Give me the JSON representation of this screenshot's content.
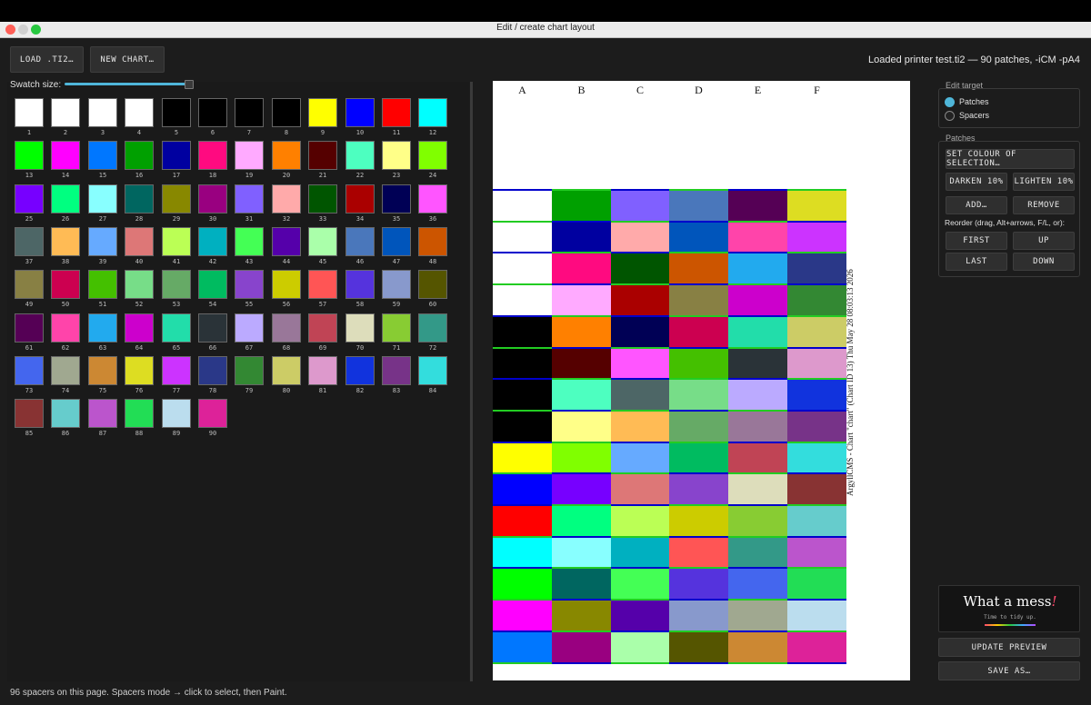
{
  "window": {
    "title": "Edit / create chart layout"
  },
  "toolbar": {
    "load_label": "LOAD .TI2…",
    "new_chart_label": "NEW CHART…"
  },
  "status_top": "Loaded printer test.ti2 — 90 patches, -iCM -pA4",
  "swatch_size": {
    "label": "Swatch size:",
    "value_fraction": 1.0
  },
  "swatches": [
    {
      "n": "1",
      "c": "#ffffff"
    },
    {
      "n": "2",
      "c": "#ffffff"
    },
    {
      "n": "3",
      "c": "#ffffff"
    },
    {
      "n": "4",
      "c": "#ffffff"
    },
    {
      "n": "5",
      "c": "#000000"
    },
    {
      "n": "6",
      "c": "#000000"
    },
    {
      "n": "7",
      "c": "#000000"
    },
    {
      "n": "8",
      "c": "#000000"
    },
    {
      "n": "9",
      "c": "#ffff00"
    },
    {
      "n": "10",
      "c": "#0000ff"
    },
    {
      "n": "11",
      "c": "#ff0000"
    },
    {
      "n": "12",
      "c": "#00ffff"
    },
    {
      "n": "13",
      "c": "#00ff00"
    },
    {
      "n": "14",
      "c": "#ff00ff"
    },
    {
      "n": "15",
      "c": "#0077ff"
    },
    {
      "n": "16",
      "c": "#00a000"
    },
    {
      "n": "17",
      "c": "#0000a0"
    },
    {
      "n": "18",
      "c": "#ff0a80"
    },
    {
      "n": "19",
      "c": "#ffaaff"
    },
    {
      "n": "20",
      "c": "#ff8000"
    },
    {
      "n": "21",
      "c": "#550000"
    },
    {
      "n": "22",
      "c": "#4dffc0"
    },
    {
      "n": "23",
      "c": "#ffff88"
    },
    {
      "n": "24",
      "c": "#80ff00"
    },
    {
      "n": "25",
      "c": "#7700ff"
    },
    {
      "n": "26",
      "c": "#00ff80"
    },
    {
      "n": "27",
      "c": "#88ffff"
    },
    {
      "n": "28",
      "c": "#006660"
    },
    {
      "n": "29",
      "c": "#888800"
    },
    {
      "n": "30",
      "c": "#990080"
    },
    {
      "n": "31",
      "c": "#8060ff"
    },
    {
      "n": "32",
      "c": "#ffaaaa"
    },
    {
      "n": "33",
      "c": "#005500"
    },
    {
      "n": "34",
      "c": "#aa0000"
    },
    {
      "n": "35",
      "c": "#000055"
    },
    {
      "n": "36",
      "c": "#ff55ff"
    },
    {
      "n": "37",
      "c": "#4d6666"
    },
    {
      "n": "38",
      "c": "#ffbb55"
    },
    {
      "n": "39",
      "c": "#66aaff"
    },
    {
      "n": "40",
      "c": "#dd7777"
    },
    {
      "n": "41",
      "c": "#bbff55"
    },
    {
      "n": "42",
      "c": "#00b0c0"
    },
    {
      "n": "43",
      "c": "#44ff55"
    },
    {
      "n": "44",
      "c": "#5500aa"
    },
    {
      "n": "45",
      "c": "#aaffaa"
    },
    {
      "n": "46",
      "c": "#4a77bb"
    },
    {
      "n": "47",
      "c": "#0055bb"
    },
    {
      "n": "48",
      "c": "#cc5500"
    },
    {
      "n": "49",
      "c": "#888044"
    },
    {
      "n": "50",
      "c": "#cc0050"
    },
    {
      "n": "51",
      "c": "#44c000"
    },
    {
      "n": "52",
      "c": "#77dd88"
    },
    {
      "n": "53",
      "c": "#66aa66"
    },
    {
      "n": "54",
      "c": "#00bb60"
    },
    {
      "n": "55",
      "c": "#8844cc"
    },
    {
      "n": "56",
      "c": "#cccc00"
    },
    {
      "n": "57",
      "c": "#ff5555"
    },
    {
      "n": "58",
      "c": "#5533dd"
    },
    {
      "n": "59",
      "c": "#8899cc"
    },
    {
      "n": "60",
      "c": "#555500"
    },
    {
      "n": "61",
      "c": "#550055"
    },
    {
      "n": "62",
      "c": "#ff44aa"
    },
    {
      "n": "63",
      "c": "#22aaee"
    },
    {
      "n": "64",
      "c": "#cc00cc"
    },
    {
      "n": "65",
      "c": "#22ddaa"
    },
    {
      "n": "66",
      "c": "#2a3338"
    },
    {
      "n": "67",
      "c": "#bbaaff"
    },
    {
      "n": "68",
      "c": "#997799"
    },
    {
      "n": "69",
      "c": "#c04455"
    },
    {
      "n": "70",
      "c": "#ddddbb"
    },
    {
      "n": "71",
      "c": "#88cc33"
    },
    {
      "n": "72",
      "c": "#339988"
    },
    {
      "n": "73",
      "c": "#4466ee"
    },
    {
      "n": "74",
      "c": "#a0a890"
    },
    {
      "n": "75",
      "c": "#cc8833"
    },
    {
      "n": "76",
      "c": "#dddd22"
    },
    {
      "n": "77",
      "c": "#cc33ff"
    },
    {
      "n": "78",
      "c": "#2a3888"
    },
    {
      "n": "79",
      "c": "#338833"
    },
    {
      "n": "80",
      "c": "#cccc66"
    },
    {
      "n": "81",
      "c": "#dd99cc"
    },
    {
      "n": "82",
      "c": "#1133dd"
    },
    {
      "n": "83",
      "c": "#773388"
    },
    {
      "n": "84",
      "c": "#33dddd"
    },
    {
      "n": "85",
      "c": "#883333"
    },
    {
      "n": "86",
      "c": "#66cccc"
    },
    {
      "n": "87",
      "c": "#bb55cc"
    },
    {
      "n": "88",
      "c": "#22dd55"
    },
    {
      "n": "89",
      "c": "#bbddee"
    },
    {
      "n": "90",
      "c": "#dd2299"
    }
  ],
  "chart": {
    "columns": [
      "A",
      "B",
      "C",
      "D",
      "E",
      "F"
    ],
    "vertical_text": "ArgyllCMS - Chart \"chart\" (Chart ID 13) Thu May 28 08:03:13 2026",
    "cells": [
      [
        "#ffffff",
        "#ffffff",
        "#ffffff",
        "#ffffff",
        "#000000",
        "#000000",
        "#000000",
        "#000000",
        "#ffff00",
        "#0000ff",
        "#ff0000",
        "#00ffff",
        "#00ff00",
        "#ff00ff",
        "#0077ff"
      ],
      [
        "#00a000",
        "#0000a0",
        "#ff0a80",
        "#ffaaff",
        "#ff8000",
        "#550000",
        "#4dffc0",
        "#ffff88",
        "#80ff00",
        "#7700ff",
        "#00ff80",
        "#88ffff",
        "#006660",
        "#888800",
        "#990080"
      ],
      [
        "#8060ff",
        "#ffaaaa",
        "#005500",
        "#aa0000",
        "#000055",
        "#ff55ff",
        "#4d6666",
        "#ffbb55",
        "#66aaff",
        "#dd7777",
        "#bbff55",
        "#00b0c0",
        "#44ff55",
        "#5500aa",
        "#aaffaa"
      ],
      [
        "#4a77bb",
        "#0055bb",
        "#cc5500",
        "#888044",
        "#cc0050",
        "#44c000",
        "#77dd88",
        "#66aa66",
        "#00bb60",
        "#8844cc",
        "#cccc00",
        "#ff5555",
        "#5533dd",
        "#8899cc",
        "#555500"
      ],
      [
        "#550055",
        "#ff44aa",
        "#22aaee",
        "#cc00cc",
        "#22ddaa",
        "#2a3338",
        "#bbaaff",
        "#997799",
        "#c04455",
        "#ddddbb",
        "#88cc33",
        "#339988",
        "#4466ee",
        "#a0a890",
        "#cc8833"
      ],
      [
        "#dddd22",
        "#cc33ff",
        "#2a3888",
        "#338833",
        "#cccc66",
        "#dd99cc",
        "#1133dd",
        "#773388",
        "#33dddd",
        "#883333",
        "#66cccc",
        "#bb55cc",
        "#22dd55",
        "#bbddee",
        "#dd2299"
      ]
    ]
  },
  "edit_target": {
    "title": "Edit target",
    "options": [
      {
        "label": "Patches",
        "selected": true
      },
      {
        "label": "Spacers",
        "selected": false
      }
    ]
  },
  "patches": {
    "title": "Patches",
    "set_colour": "SET COLOUR OF SELECTION…",
    "darken": "DARKEN 10%",
    "lighten": "LIGHTEN 10%",
    "add": "ADD…",
    "remove": "REMOVE",
    "reorder_label": "Reorder (drag, Alt+arrows, F/L, or):",
    "first": "FIRST",
    "up": "UP",
    "last": "LAST",
    "down": "DOWN"
  },
  "mess": {
    "title": "What a mess",
    "bang": "!",
    "subtitle": "Time to tidy up."
  },
  "actions": {
    "update_preview": "UPDATE PREVIEW",
    "save_as": "SAVE AS…"
  },
  "bottom_status": "96 spacers on this page. Spacers mode → click to select, then Paint.",
  "colors": {
    "accent": "#4fb6d9",
    "spacer_blue": "#0000cc",
    "spacer_green": "#22cc22"
  }
}
